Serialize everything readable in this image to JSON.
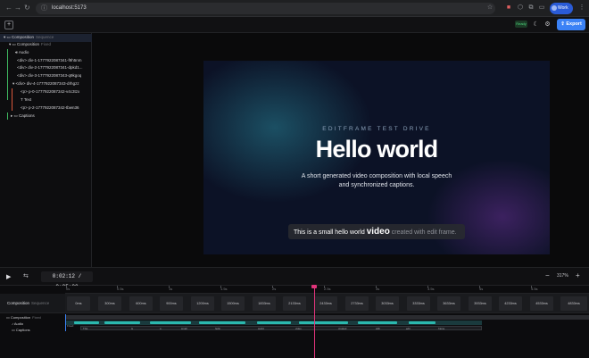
{
  "browser": {
    "url": "localhost:5173",
    "profile": "Work",
    "back_icon": "arrow-left-icon",
    "forward_icon": "arrow-right-icon",
    "reload_icon": "reload-icon"
  },
  "appbar": {
    "status_badge": "Ready",
    "export_label": "Export"
  },
  "tree": {
    "nodes": [
      {
        "label": "Composition",
        "sub": "Sequence"
      },
      {
        "label": "Composition",
        "sub": "Fixed"
      },
      {
        "label": "Audio",
        "sub": ""
      },
      {
        "label": "<div> div-1-1777922087341-f9h5nm",
        "sub": ""
      },
      {
        "label": "<div> div-2-1777922087341-dpkd1...",
        "sub": ""
      },
      {
        "label": "<div> div-3-1777922087343-q9kgoq",
        "sub": ""
      },
      {
        "label": "<div> div-4-1777922087343-drhgzz",
        "sub": ""
      },
      {
        "label": "<p> p-0-1777922087342-v4c3tzx",
        "sub": ""
      },
      {
        "label": "Text",
        "sub": ""
      },
      {
        "label": "<p> p-2-1777922087342-tbwn36",
        "sub": ""
      },
      {
        "label": "Captions",
        "sub": ""
      }
    ]
  },
  "preview": {
    "kicker": "EDITFRAME TEST DRIVE",
    "title": "Hello world",
    "description": "A short generated video composition with local speech and synchronized captions.",
    "caption_before": "This is a small hello world ",
    "caption_active": "video",
    "caption_after": " created with edit frame."
  },
  "controls": {
    "time": "0:02:12 / 0:05:00",
    "zoom": "317%"
  },
  "timeline": {
    "ruler": [
      "0s",
      "0.5s",
      "1s",
      "1.5s",
      "2s",
      "2.5s",
      "3s",
      "3.5s",
      "4s",
      "4.5s"
    ],
    "frames": [
      "0ms",
      "300ms",
      "600ms",
      "900ms",
      "1200ms",
      "1500ms",
      "1833ms",
      "2133ms",
      "2433ms",
      "2733ms",
      "3033ms",
      "3333ms",
      "3633ms",
      "3933ms",
      "4233ms",
      "4533ms",
      "4833ms"
    ],
    "track_label": "Composition",
    "track_sub": "Sequence",
    "rows": [
      {
        "label": "Composition",
        "sub": "Fixed"
      },
      {
        "label": "Audio",
        "sub": ""
      },
      {
        "label": "Captions",
        "sub": ""
      }
    ],
    "comp_bar_label": "Fixed",
    "caption_words": [
      "This",
      "is",
      "a",
      "small",
      "hello",
      "world",
      "video",
      "created",
      "with",
      "edit",
      "frame."
    ]
  }
}
